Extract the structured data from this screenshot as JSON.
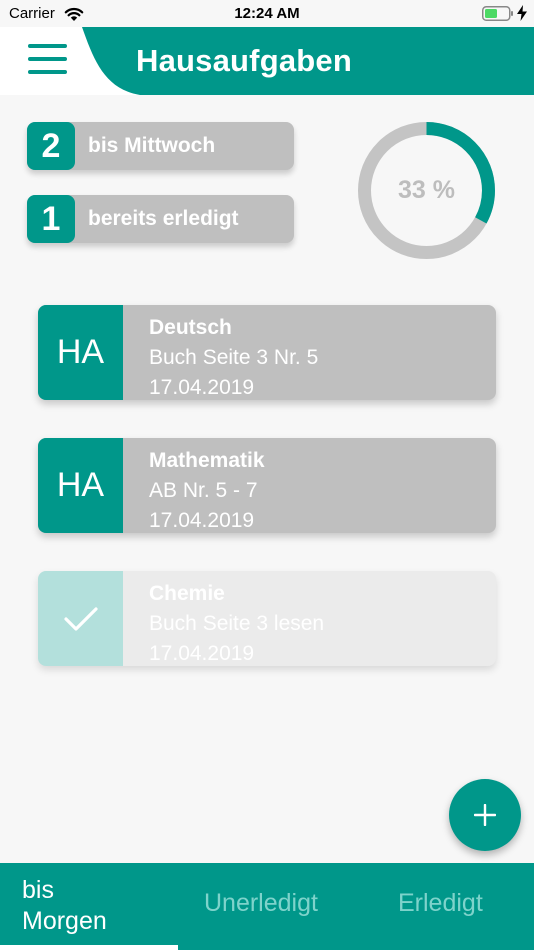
{
  "status_bar": {
    "carrier": "Carrier",
    "time": "12:24 AM",
    "icons": [
      "wifi-icon",
      "battery-icon",
      "charging-bolt-icon"
    ]
  },
  "header": {
    "title": "Hausaufgaben",
    "menu_icon": "hamburger-menu-icon"
  },
  "summary": {
    "due": {
      "count": "2",
      "label": "bis Mittwoch"
    },
    "completed": {
      "count": "1",
      "label": "bereits erledigt"
    }
  },
  "progress": {
    "value": 0.33,
    "label": "33 %"
  },
  "homework": [
    {
      "badge": "HA",
      "subject": "Deutsch",
      "task": "Buch Seite 3 Nr. 5",
      "date": "17.04.2019",
      "done": false
    },
    {
      "badge": "HA",
      "subject": "Mathematik",
      "task": "AB Nr. 5 - 7",
      "date": "17.04.2019",
      "done": false
    },
    {
      "badge": "check-icon",
      "subject": "Chemie",
      "task": "Buch Seite 3 lesen",
      "date": "17.04.2019",
      "done": true
    }
  ],
  "fab": {
    "icon": "plus-icon"
  },
  "tabs": [
    {
      "line1": "bis",
      "line2": "Morgen",
      "active": true
    },
    {
      "label": "Unerledigt",
      "active": false
    },
    {
      "label": "Erledigt",
      "active": false
    }
  ],
  "colors": {
    "primary": "#00978a",
    "card": "#bfbfbf",
    "card_done": "#ebebeb",
    "badge_done": "#b3e0dc",
    "tab_inactive": "#7ed3cb",
    "ring_track": "#c4c4c4"
  }
}
